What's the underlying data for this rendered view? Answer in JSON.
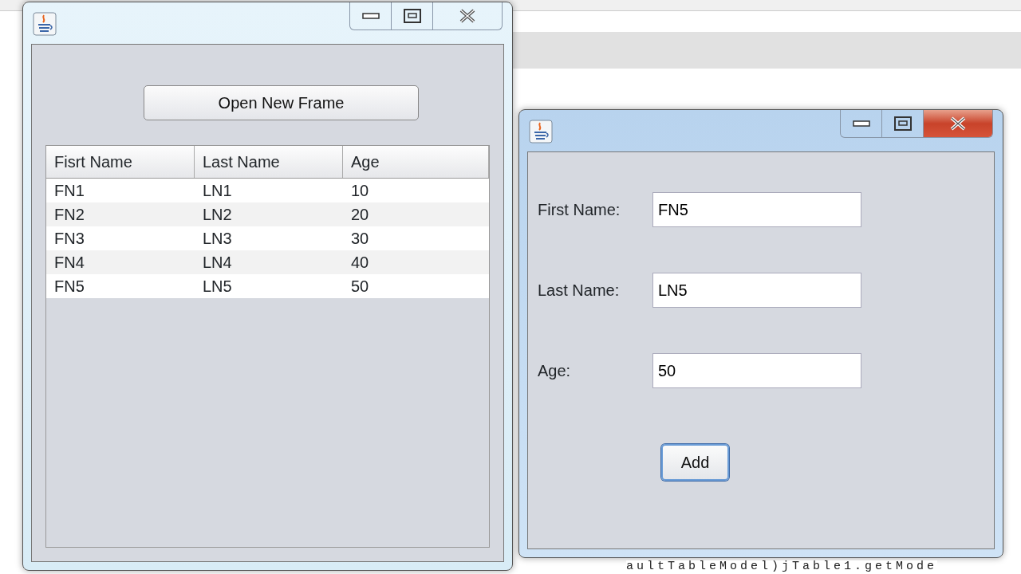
{
  "background_editor": {
    "code_line": "aultTableModel)jTable1.getMode"
  },
  "windows": [
    {
      "kind": "table_frame",
      "active": false,
      "button": {
        "label": "Open New Frame"
      },
      "table": {
        "columns": [
          "Fisrt Name",
          "Last Name",
          "Age"
        ],
        "rows": [
          [
            "FN1",
            "LN1",
            "10"
          ],
          [
            "FN2",
            "LN2",
            "20"
          ],
          [
            "FN3",
            "LN3",
            "30"
          ],
          [
            "FN4",
            "LN4",
            "40"
          ],
          [
            "FN5",
            "LN5",
            "50"
          ]
        ]
      }
    },
    {
      "kind": "form_frame",
      "active": true,
      "fields": [
        {
          "label": "First Name:",
          "value": "FN5"
        },
        {
          "label": "Last Name:",
          "value": "LN5"
        },
        {
          "label": "Age:",
          "value": "50"
        }
      ],
      "button": {
        "label": "Add",
        "focused": true
      }
    }
  ]
}
